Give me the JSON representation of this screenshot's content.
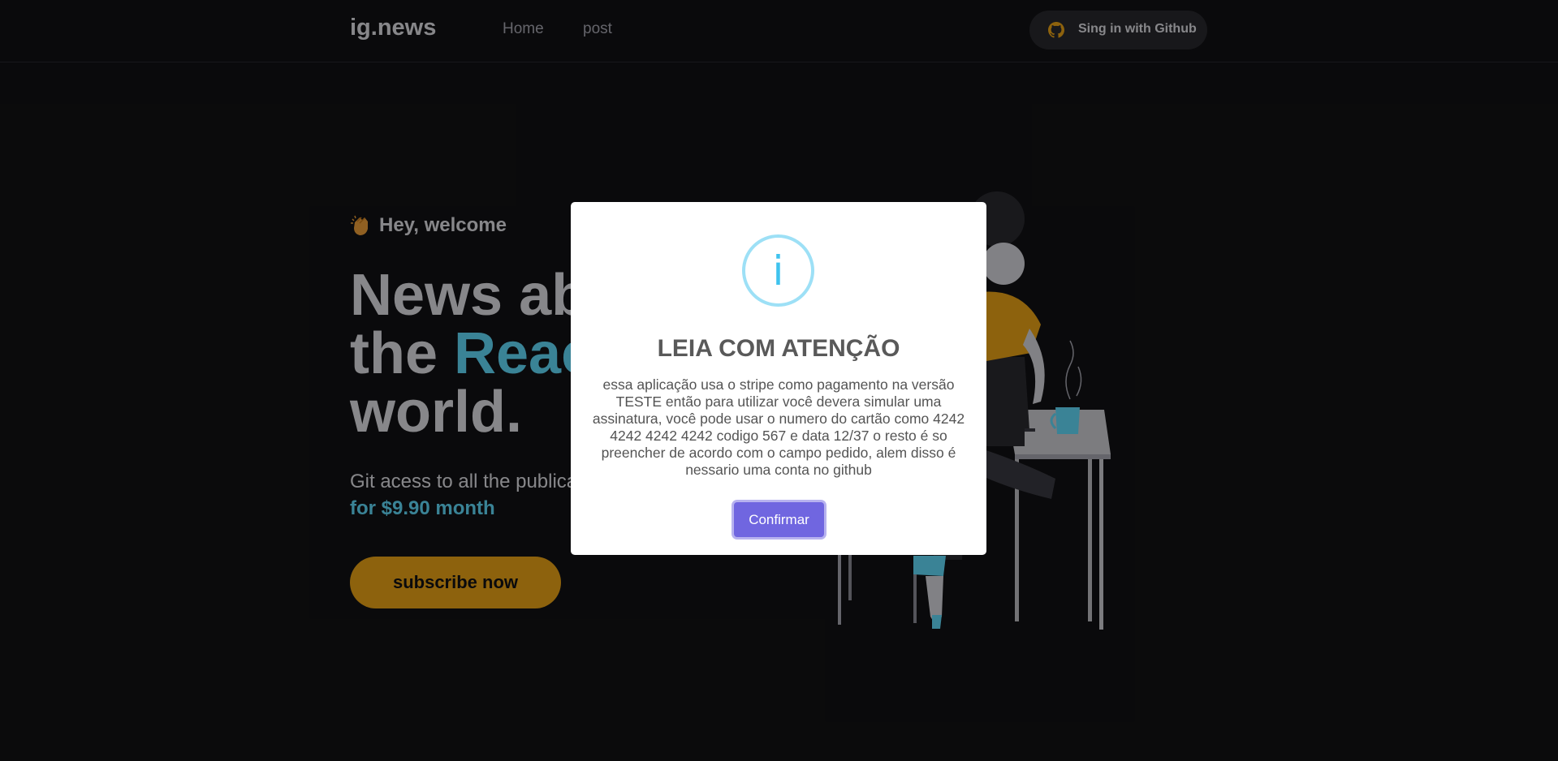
{
  "header": {
    "logo": "ig.news",
    "nav": [
      {
        "label": "Home"
      },
      {
        "label": "post"
      }
    ],
    "signin_label": "Sing in with Github",
    "signin_icon": "github-icon"
  },
  "hero": {
    "welcome": "Hey, welcome",
    "welcome_icon": "clapping-hands-icon",
    "title_line1": "News about",
    "title_line2_prefix": "the ",
    "title_line2_accent": "React",
    "title_line3": "world.",
    "subtitle": "Git acess to all the publications",
    "price": "for $9.90 month",
    "subscribe_label": "subscribe now"
  },
  "modal": {
    "icon": "info-icon",
    "icon_glyph": "i",
    "title": "LEIA COM ATENÇÃO",
    "text": "essa aplicação usa o stripe como pagamento na versão TESTE então para utilizar você devera simular uma assinatura, você pode usar o numero do cartão como 4242 4242 4242 4242 codigo 567 e data 12/37 o resto é so preencher de acordo com o campo pedido, alem disso é nessario uma conta no github",
    "confirm_label": "Confirmar"
  },
  "colors": {
    "background": "#121214",
    "accent_cyan": "#61dafb",
    "accent_yellow": "#eba417",
    "confirm_button": "#7066e0",
    "info_icon": "#3fc3ee"
  }
}
